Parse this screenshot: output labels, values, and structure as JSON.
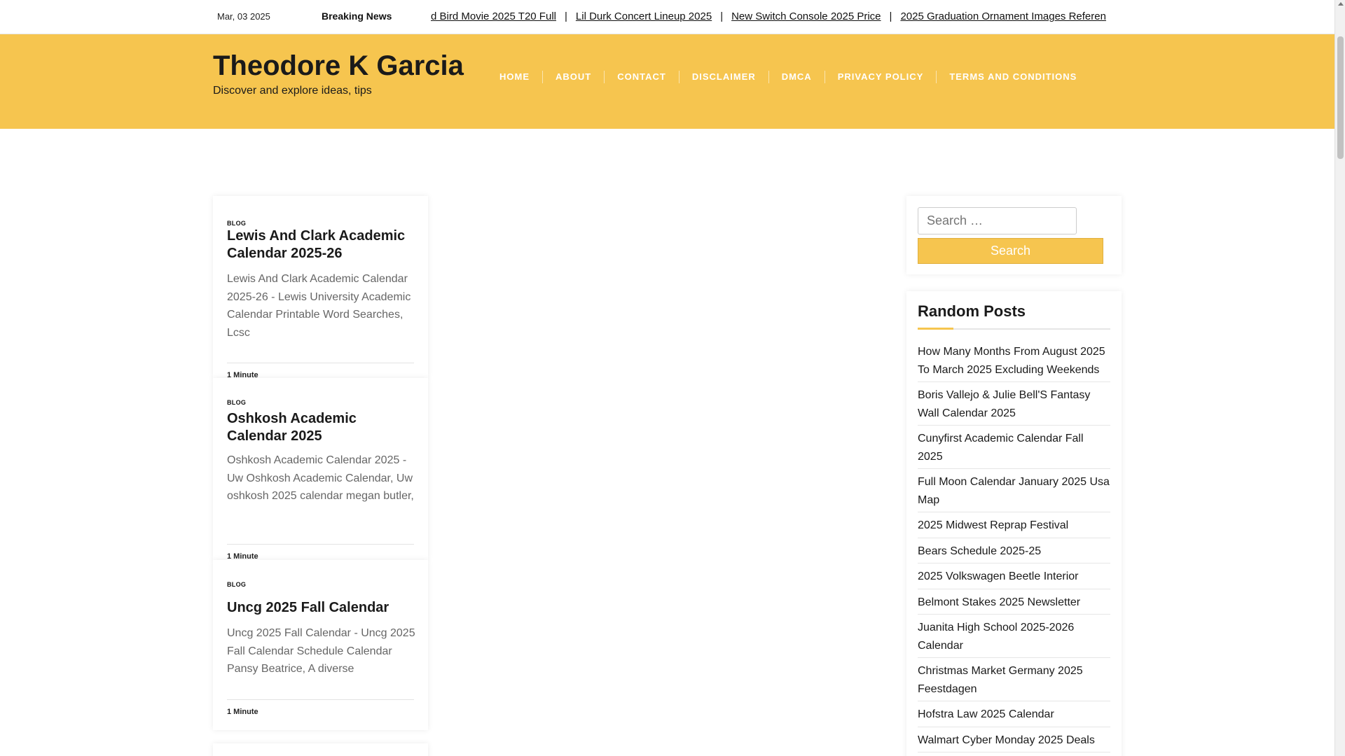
{
  "topbar": {
    "date": "Mar, 03 2025",
    "breaking_label": "Breaking News",
    "ticker": [
      "d Bird Movie 2025 T20 Full",
      "Lil Durk Concert Lineup 2025",
      "New Switch Console 2025 Price",
      "2025 Graduation Ornament Images Referen"
    ]
  },
  "header": {
    "site_title": "Theodore K Garcia",
    "tagline": "Discover and explore ideas, tips",
    "nav": [
      "HOME",
      "ABOUT",
      "CONTACT",
      "DISCLAIMER",
      "DMCA",
      "PRIVACY POLICY",
      "TERMS AND CONDITIONS"
    ]
  },
  "posts": [
    {
      "category": "BLOG",
      "title": "Lewis And Clark Academic Calendar 2025-26",
      "excerpt": "Lewis And Clark Academic Calendar 2025-26 - Lewis University Academic Calendar Printable Word Searches, Lcsc",
      "read_time": "1 Minute"
    },
    {
      "category": "BLOG",
      "title": "Oshkosh Academic Calendar 2025",
      "excerpt": "Oshkosh Academic Calendar 2025 - Uw Oshkosh Academic Calendar, Uw oshkosh 2025 calendar megan butler,",
      "read_time": "1 Minute"
    },
    {
      "category": "BLOG",
      "title": "Uncg 2025 Fall Calendar",
      "excerpt": "Uncg 2025 Fall Calendar - Uncg 2025 Fall Calendar Schedule Calendar Pansy Beatrice, A diverse",
      "read_time": "1 Minute"
    }
  ],
  "search": {
    "placeholder": "Search …",
    "button_label": "Search"
  },
  "random_posts": {
    "title": "Random Posts",
    "items": [
      "How Many Months From August 2025 To March 2025 Excluding Weekends",
      "Boris Vallejo & Julie Bell'S Fantasy Wall Calendar 2025",
      "Cunyfirst Academic Calendar Fall 2025",
      "Full Moon Calendar January 2025 Usa Map",
      "2025 Midwest Reprap Festival",
      "Bears Schedule 2025-25",
      "2025 Volkswagen Beetle Interior",
      "Belmont Stakes 2025 Newsletter",
      "Juanita High School 2025-2026 Calendar",
      "Christmas Market Germany 2025 Feestdagen",
      "Hofstra Law 2025 Calendar",
      "Walmart Cyber Monday 2025 Deals"
    ]
  },
  "colors": {
    "accent": "#f6c54f"
  }
}
